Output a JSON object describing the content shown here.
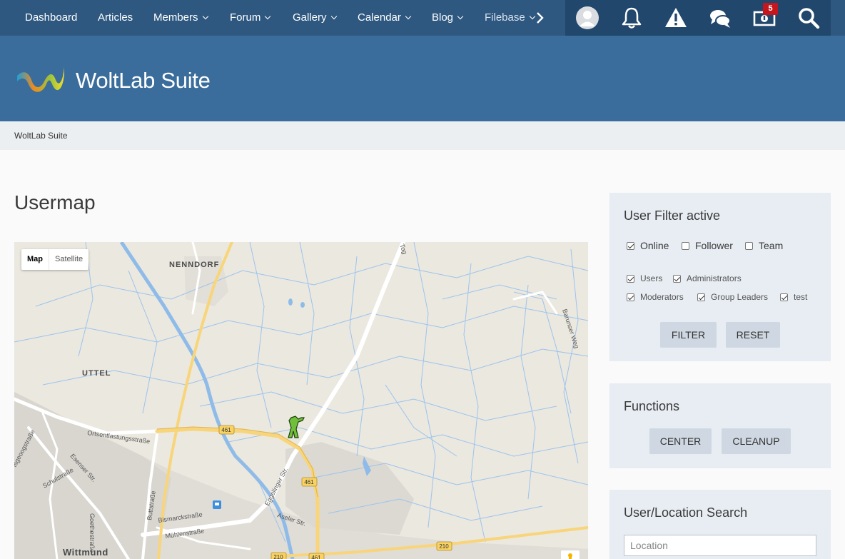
{
  "nav": {
    "items": [
      {
        "label": "Dashboard",
        "dropdown": false
      },
      {
        "label": "Articles",
        "dropdown": false
      },
      {
        "label": "Members",
        "dropdown": true
      },
      {
        "label": "Forum",
        "dropdown": true
      },
      {
        "label": "Gallery",
        "dropdown": true
      },
      {
        "label": "Calendar",
        "dropdown": true
      },
      {
        "label": "Blog",
        "dropdown": true
      },
      {
        "label": "Filebase",
        "dropdown": true
      }
    ],
    "more_icon": "chevron-right-icon",
    "user_icons": [
      "avatar",
      "bell-icon",
      "warning-icon",
      "chat-bubbles-icon",
      "gift-voucher-icon",
      "search-icon"
    ],
    "notification_badge": "5"
  },
  "header": {
    "logo_text": "WoltLab Suite"
  },
  "breadcrumb": {
    "items": [
      "WoltLab Suite"
    ]
  },
  "page": {
    "title": "Usermap"
  },
  "map": {
    "type_buttons": [
      "Map",
      "Satellite"
    ],
    "active_type": "Map",
    "place_labels": [
      "NENNDORF",
      "UTTEL",
      "Wittmund"
    ],
    "street_labels": [
      "Ortsentlastungsstraße",
      "Esenser Str.",
      "Schulstraße",
      "Goethestraße",
      "Buttstraße",
      "Bismarckstraße",
      "Mühlenstraße",
      "Eggelinger Str.",
      "Aseler Str.",
      "Barunser Weg",
      "Tog",
      "Isgeoogstraße"
    ],
    "road_numbers": [
      "461",
      "461",
      "210",
      "210",
      "461"
    ]
  },
  "filter": {
    "title": "User Filter active",
    "options": [
      {
        "label": "Online",
        "checked": true
      },
      {
        "label": "Follower",
        "checked": false
      },
      {
        "label": "Team",
        "checked": false
      }
    ],
    "groups": [
      {
        "label": "Users",
        "checked": true
      },
      {
        "label": "Administrators",
        "checked": true
      },
      {
        "label": "Moderators",
        "checked": true
      },
      {
        "label": "Group Leaders",
        "checked": true
      },
      {
        "label": "test",
        "checked": true
      }
    ],
    "filter_button": "FILTER",
    "reset_button": "RESET"
  },
  "functions": {
    "title": "Functions",
    "center_button": "CENTER",
    "cleanup_button": "CLEANUP"
  },
  "search": {
    "title": "User/Location Search",
    "placeholder": "Location"
  },
  "colors": {
    "nav_bg": "#2f5880",
    "userpanel_bg": "#21476c",
    "header_bg": "#3a6d9c",
    "sidebar_bg": "#e7edf3",
    "button_bg": "#cfd8e2",
    "badge": "#c4161c",
    "map_water": "#8fbbe9",
    "map_road": "#f8d57a"
  }
}
